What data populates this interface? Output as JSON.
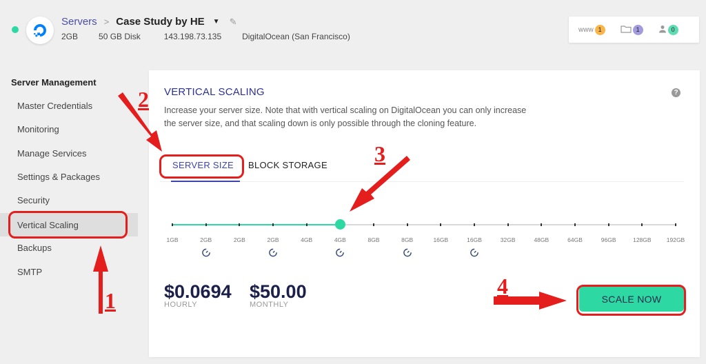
{
  "header": {
    "breadcrumb_root": "Servers",
    "breadcrumb_sep": ">",
    "server_name": "Case Study by HE",
    "meta": {
      "ram": "2GB",
      "disk": "50 GB Disk",
      "ip": "143.198.73.135",
      "location": "DigitalOcean (San Francisco)"
    }
  },
  "top_widget": {
    "www_label": "www",
    "www_count": "1",
    "files_count": "1",
    "users_count": "0"
  },
  "sidebar": {
    "heading": "Server Management",
    "items": [
      {
        "label": "Master Credentials"
      },
      {
        "label": "Monitoring"
      },
      {
        "label": "Manage Services"
      },
      {
        "label": "Settings & Packages"
      },
      {
        "label": "Security"
      },
      {
        "label": "Vertical Scaling"
      },
      {
        "label": "Backups"
      },
      {
        "label": "SMTP"
      }
    ]
  },
  "panel": {
    "title": "VERTICAL SCALING",
    "description": "Increase your server size. Note that with vertical scaling on DigitalOcean you can only increase the server size, and that scaling down is only possible through the cloning feature.",
    "help": "?",
    "tabs": {
      "server_size": "SERVER SIZE",
      "block_storage": "BLOCK STORAGE"
    },
    "slider": {
      "labels": [
        "1GB",
        "2GB",
        "2GB",
        "2GB",
        "4GB",
        "4GB",
        "8GB",
        "8GB",
        "16GB",
        "16GB",
        "32GB",
        "48GB",
        "64GB",
        "96GB",
        "128GB",
        "192GB"
      ],
      "selected_index": 5
    },
    "hourly_price": "$0.0694",
    "hourly_label": "HOURLY",
    "monthly_price": "$50.00",
    "monthly_label": "MONTHLY",
    "scale_button": "SCALE NOW"
  },
  "annotations": {
    "n1": "1",
    "n2": "2",
    "n3": "3",
    "n4": "4"
  },
  "colors": {
    "accent": "#2ed8a3",
    "brand": "#3d44b0",
    "annotation": "#e41d1d"
  }
}
